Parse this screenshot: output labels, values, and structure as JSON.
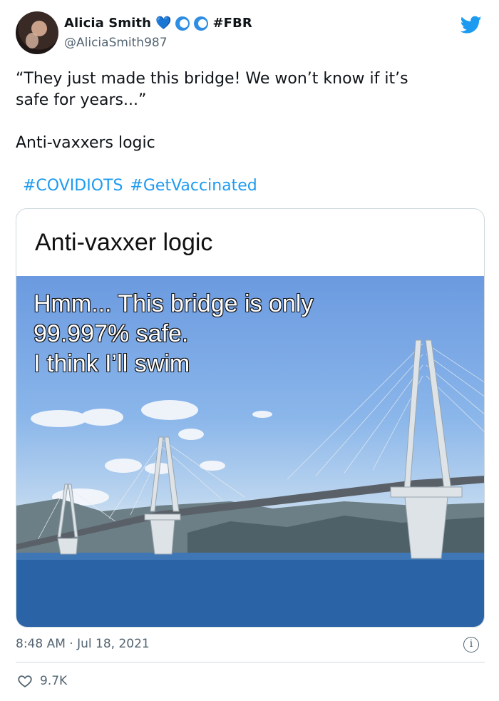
{
  "author": {
    "display_name": "Alicia Smith",
    "emojis": "💙",
    "tag": "#FBR",
    "handle": "@AliciaSmith987",
    "avatar_icon": "profile-photo"
  },
  "brand_icon": "twitter-bird-icon",
  "tweet": {
    "paragraphs": [
      "“They just made this bridge! We won’t know if it’s\nsafe for years...”",
      "Anti-vaxxers logic"
    ],
    "hashtags": [
      "#COVIDIOTS",
      "#GetVaccinated"
    ]
  },
  "media": {
    "title": "Anti-vaxxer logic",
    "caption_lines": [
      "Hmm... This bridge is only",
      "99.997% safe.",
      "I think I’ll swim"
    ]
  },
  "meta": {
    "timestamp": "8:48 AM · Jul 18, 2021",
    "info_label": "i"
  },
  "engagement": {
    "likes": "9.7K"
  },
  "colors": {
    "link": "#1d9bf0",
    "secondary_text": "#536471",
    "border": "#cfd9de"
  }
}
